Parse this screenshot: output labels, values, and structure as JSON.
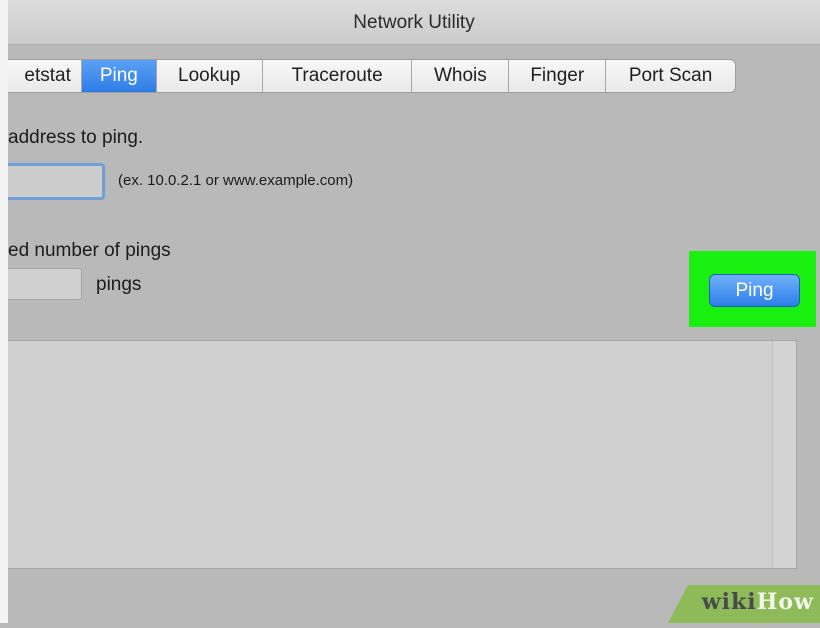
{
  "window": {
    "title": "Network Utility"
  },
  "tabs": [
    {
      "label": "etstat",
      "active": false
    },
    {
      "label": "Ping",
      "active": true
    },
    {
      "label": "Lookup",
      "active": false
    },
    {
      "label": "Traceroute",
      "active": false
    },
    {
      "label": "Whois",
      "active": false
    },
    {
      "label": "Finger",
      "active": false
    },
    {
      "label": "Port Scan",
      "active": false
    }
  ],
  "address": {
    "label": "address to ping.",
    "value": "",
    "hint": "(ex. 10.0.2.1 or www.example.com)"
  },
  "count": {
    "label": "ed number of pings",
    "value": "",
    "unit": "pings"
  },
  "action": {
    "ping_label": "Ping"
  },
  "output": {
    "text": ""
  },
  "watermark": {
    "wiki": "wiki",
    "how": "How"
  },
  "colors": {
    "accent": "#2f7de6",
    "highlight": "#19f00f",
    "background": "#b9b9b9"
  }
}
